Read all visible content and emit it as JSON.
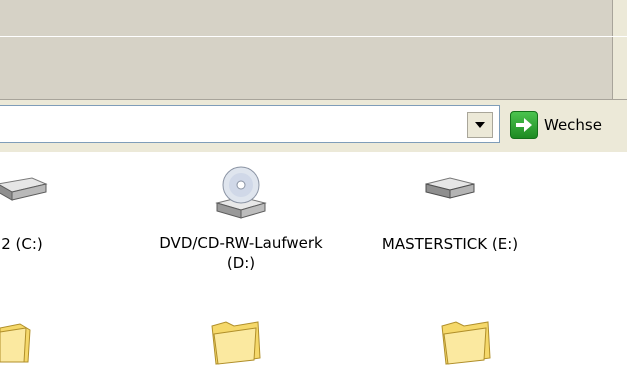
{
  "address_bar": {
    "go_label": "Wechse"
  },
  "drives": [
    {
      "label": "2 (C:)",
      "icon": "hard-disk-icon"
    },
    {
      "label_line1": "DVD/CD-RW-Laufwerk",
      "label_line2": "(D:)",
      "icon": "dvd-drive-icon"
    },
    {
      "label": "MASTERSTICK (E:)",
      "icon": "removable-disk-icon"
    }
  ],
  "folders": [
    {
      "icon": "folder-icon"
    },
    {
      "icon": "folder-icon"
    },
    {
      "icon": "folder-icon"
    }
  ],
  "colors": {
    "toolbar": "#d6d2c6",
    "go_green": "#2f9e33",
    "field_border": "#7f9db9",
    "folder_yellow": "#f5d86a"
  }
}
